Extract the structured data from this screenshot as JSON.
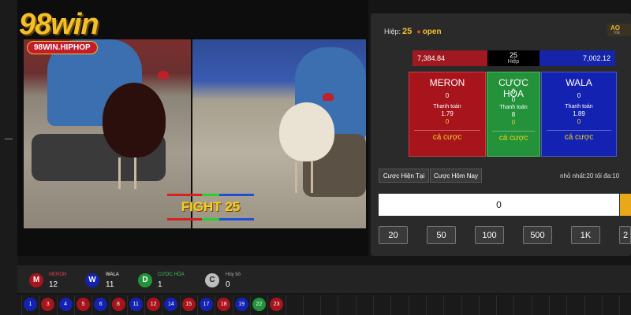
{
  "brand": {
    "logo_text": "98win",
    "sub_tag": "98WIN.HIPHOP"
  },
  "stream": {
    "overlay_text": "FIGHT 25"
  },
  "status": {
    "hiep_label": "Hiệp:",
    "round": "25",
    "state": "open"
  },
  "scoreboard": {
    "meron_total": "7,384.84",
    "round_number": "25",
    "round_label": "Hiệp",
    "wala_total": "7,002.12"
  },
  "bets": {
    "meron": {
      "title": "MERON",
      "amount": "0",
      "payout_label": "Thanh toán",
      "odds": "1.79",
      "my_bet": "0",
      "cta": "cá cược",
      "color": "#a8141c"
    },
    "draw": {
      "title": "CƯỢC HÒA",
      "amount1": "0",
      "amount2": "0",
      "payout_label": "Thanh toán",
      "odds": "8",
      "my_bet": "0",
      "cta": "cá cược",
      "color": "#23923a"
    },
    "wala": {
      "title": "WALA",
      "amount": "0",
      "payout_label": "Thanh toán",
      "odds": "1.89",
      "my_bet": "0",
      "cta": "cá cược",
      "color": "#1322b0"
    }
  },
  "tabs": {
    "current": "Cược Hiện Tại",
    "today": "Cược Hôm Nay"
  },
  "limits": {
    "text": "nhỏ nhất:20  tối đa:10"
  },
  "amount_input": {
    "value": "0"
  },
  "chips": [
    "20",
    "50",
    "100",
    "500",
    "1K",
    "2"
  ],
  "stats": {
    "meron": {
      "letter": "M",
      "label": "MERON",
      "count": "12",
      "color": "#a8141c"
    },
    "wala": {
      "letter": "W",
      "label": "WALA",
      "count": "11",
      "color": "#1322b0"
    },
    "draw": {
      "letter": "D",
      "label": "CƯỢC HÒA",
      "count": "1",
      "color": "#23923a"
    },
    "cancel": {
      "letter": "C",
      "label": "Hủy bỏ",
      "count": "0",
      "color": "#bdbdbd"
    }
  },
  "history": [
    {
      "n": "1",
      "c": "blue"
    },
    {
      "n": "3",
      "c": "red"
    },
    {
      "n": "4",
      "c": "blue"
    },
    {
      "n": "5",
      "c": "red"
    },
    {
      "n": "6",
      "c": "blue"
    },
    {
      "n": "8",
      "c": "red"
    },
    {
      "n": "11",
      "c": "blue"
    },
    {
      "n": "12",
      "c": "red"
    },
    {
      "n": "14",
      "c": "blue"
    },
    {
      "n": "15",
      "c": "red"
    },
    {
      "n": "17",
      "c": "blue"
    },
    {
      "n": "18",
      "c": "red"
    },
    {
      "n": "19",
      "c": "blue"
    },
    {
      "n": "22",
      "c": "green"
    },
    {
      "n": "23",
      "c": "red"
    }
  ]
}
